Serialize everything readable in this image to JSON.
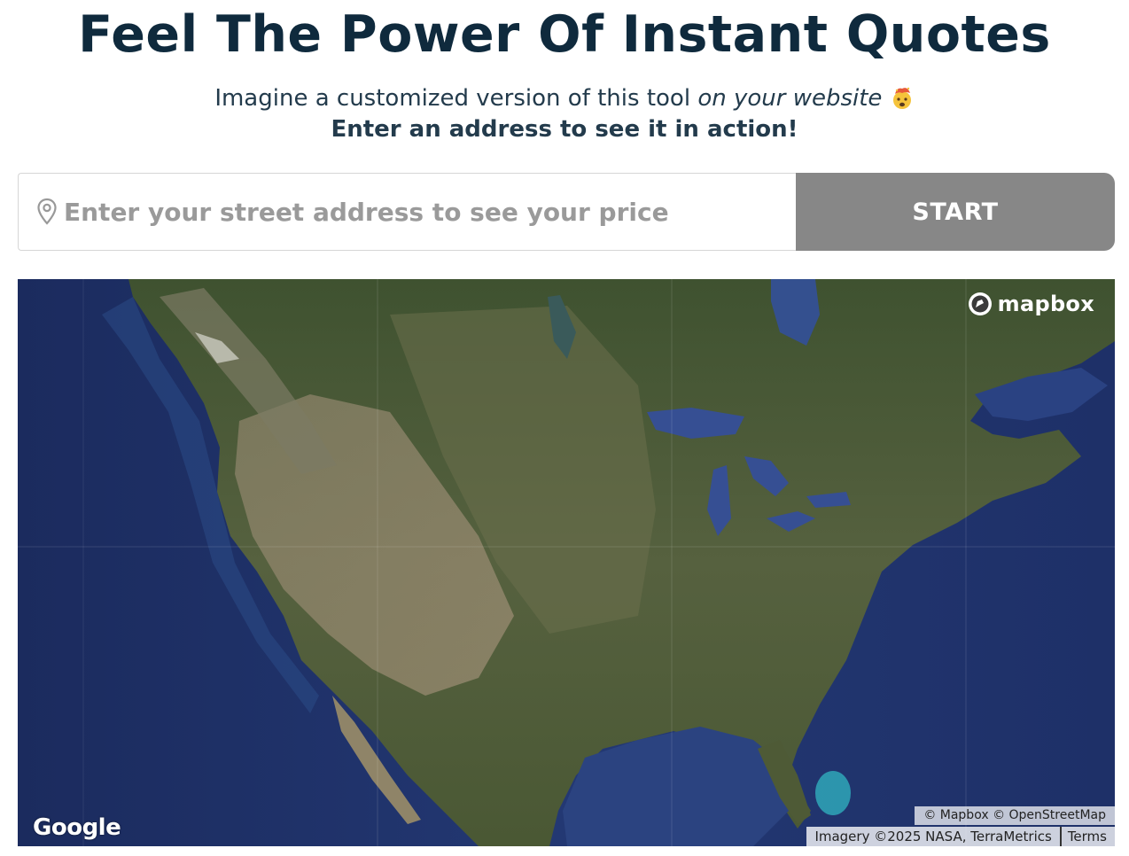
{
  "hero": {
    "title": "Feel The Power Of Instant Quotes",
    "subtitle_start": "Imagine a customized version of this tool ",
    "subtitle_emphasis": "on your website",
    "cta": "Enter an address to see it in action!"
  },
  "search": {
    "placeholder": "Enter your street address to see your price",
    "value": "",
    "start_label": "START",
    "button_color": "#878787"
  },
  "map": {
    "brand": "mapbox",
    "google_logo": "Google",
    "attribution": "© Mapbox © OpenStreetMap",
    "imagery": "Imagery ©2025 NASA, TerraMetrics",
    "terms": "Terms",
    "water_color": "#1d2f63",
    "land_color": "#4b5a38"
  },
  "icons": {
    "pin": "location-pin-icon",
    "emoji": "exploding-head-emoji-icon",
    "mapbox": "mapbox-logo-icon"
  }
}
